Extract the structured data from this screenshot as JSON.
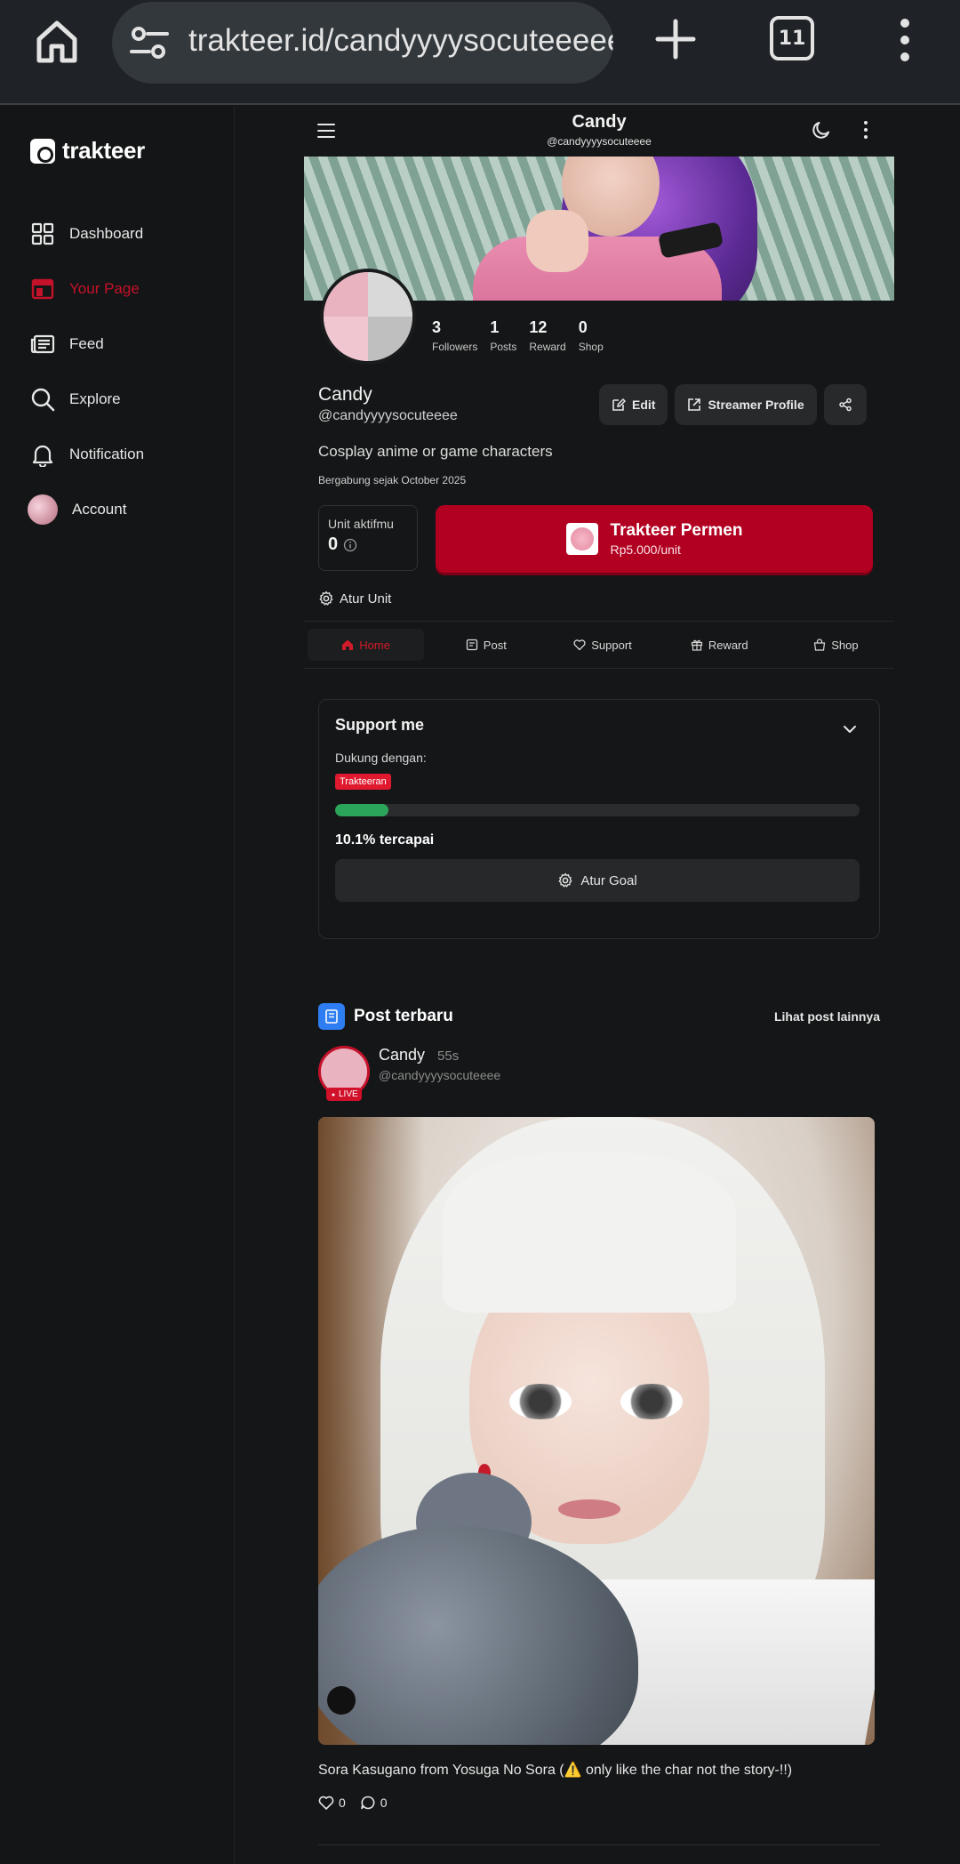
{
  "browser": {
    "url": "trakteer.id/candyyyysocuteeeee",
    "tab_count": "11"
  },
  "sidebar": {
    "brand": "trakteer",
    "items": [
      {
        "label": "Dashboard",
        "icon": "grid-icon"
      },
      {
        "label": "Your Page",
        "icon": "page-icon",
        "active": true
      },
      {
        "label": "Feed",
        "icon": "feed-icon"
      },
      {
        "label": "Explore",
        "icon": "search-icon"
      },
      {
        "label": "Notification",
        "icon": "bell-icon"
      },
      {
        "label": "Account",
        "icon": "avatar"
      }
    ]
  },
  "header": {
    "title": "Candy",
    "handle": "@candyyyysocuteeee"
  },
  "profile": {
    "name": "Candy",
    "handle": "@candyyyysocuteeee",
    "bio": "Cosplay anime or game characters",
    "joined": "Bergabung sejak October 2025",
    "stats": [
      {
        "value": "3",
        "label": "Followers"
      },
      {
        "value": "1",
        "label": "Posts"
      },
      {
        "value": "12",
        "label": "Reward"
      },
      {
        "value": "0",
        "label": "Shop"
      }
    ],
    "buttons": {
      "edit": "Edit",
      "streamer": "Streamer Profile"
    }
  },
  "unit": {
    "label": "Unit aktifmu",
    "value": "0"
  },
  "trakteer_button": {
    "title": "Trakteer Permen",
    "price": "Rp5.000/unit"
  },
  "atur_unit": "Atur Unit",
  "tabs": [
    {
      "label": "Home",
      "active": true
    },
    {
      "label": "Post"
    },
    {
      "label": "Support"
    },
    {
      "label": "Reward"
    },
    {
      "label": "Shop"
    }
  ],
  "support": {
    "title": "Support me",
    "dukung": "Dukung dengan:",
    "tag": "Trakteeran",
    "progress": 0.101,
    "percent_text": "10.1% tercapai",
    "goal_button": "Atur Goal"
  },
  "posts": {
    "title": "Post terbaru",
    "more": "Lihat post lainnya",
    "author": "Candy",
    "time": "55s",
    "handle": "@candyyyysocuteeee",
    "live": "LIVE",
    "caption": "Sora Kasugano from Yosuga No Sora (⚠️ only like the char not the story-!!)",
    "likes": "0",
    "comments": "0"
  },
  "colors": {
    "accent": "#b10020",
    "active": "#c4122a",
    "progress": "#2aa55a",
    "background": "#151617"
  }
}
